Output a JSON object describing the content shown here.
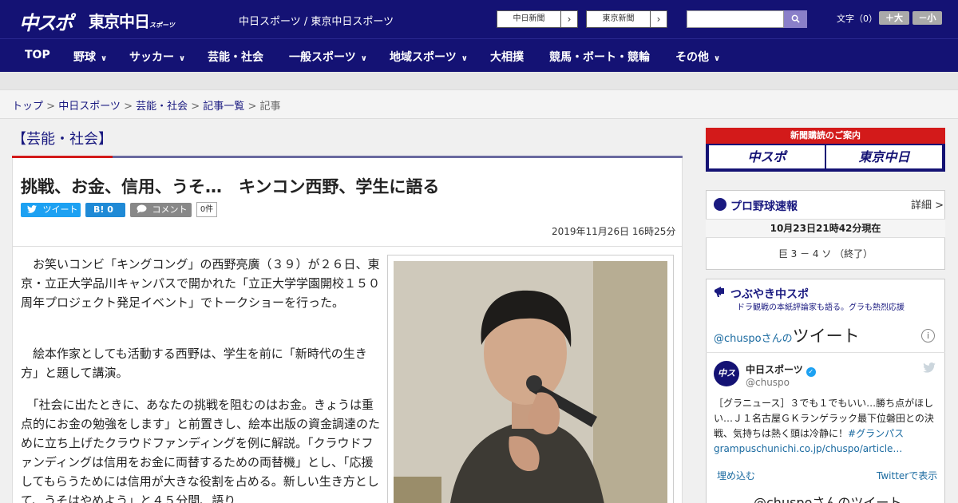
{
  "header": {
    "logo_chuspo": "中スポ",
    "logo_tokyo": "東京中日",
    "logo_tokyo_sub": "スポーツ",
    "site_names": "中日スポーツ / 東京中日スポーツ",
    "btn_chunichi": "中日新聞",
    "btn_tokyo": "東京新聞",
    "arrow": "›",
    "search_icon": "magnifier-icon",
    "fontsize_label": "文字（0）",
    "fs_plus": "＋大",
    "fs_minus": "－小"
  },
  "nav": {
    "items": [
      "TOP",
      "野球",
      "サッカー",
      "芸能・社会",
      "一般スポーツ",
      "地域スポーツ",
      "大相撲",
      "競馬・ボート・競輪",
      "その他"
    ],
    "chevron": "∨"
  },
  "breadcrumb": {
    "top": "トップ",
    "chuspo": "中日スポーツ",
    "geino": "芸能・社会",
    "list": "記事一覧",
    "current": "記事",
    "sep": " > "
  },
  "article": {
    "section": "【芸能・社会】",
    "headline": "挑戦、お金、信用、うそ…　キンコン西野、学生に語る",
    "tweet_label": "ツイート",
    "hatena_label": "B! 0",
    "comment_label": "コメント",
    "comment_count": "0件",
    "date": "2019年11月26日 16時25分",
    "paragraphs": [
      "　お笑いコンビ「キングコング」の西野亮廣（３９）が２６日、東京・立正大学品川キャンパスで開かれた「立正大学学園開校１５０周年プロジェクト発足イベント」でトークショーを行った。",
      "　絵本作家としても活動する西野は、学生を前に「新時代の生き方」と題して講演。",
      "　「社会に出たときに、あなたの挑戦を阻むのはお金。きょうは重点的にお金の勉強をします」と前置きし、絵本出版の資金調達のために立ち上げたクラウドファンディングを例に解説。「クラウドファンディングは信用をお金に両替するための両替機」とし、「応援してもらうためには信用が大きな役割を占める。新しい生き方として、うそはやめよう」と４５分間、語り"
    ]
  },
  "sidebar": {
    "subscribe_head": "新聞購読のご案内",
    "sub_chuspo": "中スポ",
    "sub_tokyo": "東京中日",
    "baseball_title": "プロ野球速報",
    "detail": "詳細 >",
    "score_date": "10月23日21時42分現在",
    "score_line": "巨 3 － 4 ソ （終了）",
    "tsubuyaki_title": "つぶやき中スポ",
    "tsubuyaki_sub": "ドラ観戦の本紙評論家も語る。グラも熱烈応援",
    "tw_head_small": "@chuspoさんの",
    "tw_head_big": "ツイート",
    "info": "i",
    "tw_name": "中日スポーツ",
    "tw_handle": "@chuspo",
    "tw_text": "［グラニュース］３でも１でもいい…勝ち点がほしい…Ｊ１名古屋ＧＫランゲラック最下位磐田との決戦、気持ちは熱く頭は冷静に！",
    "tw_hashtag": "#グランパス",
    "tw_link": "grampuschunichi.co.jp/chuspo/article…",
    "embed": "埋め込む",
    "view_on_twitter": "Twitterで表示",
    "tw_more": "@chuspoさんのツイート"
  }
}
